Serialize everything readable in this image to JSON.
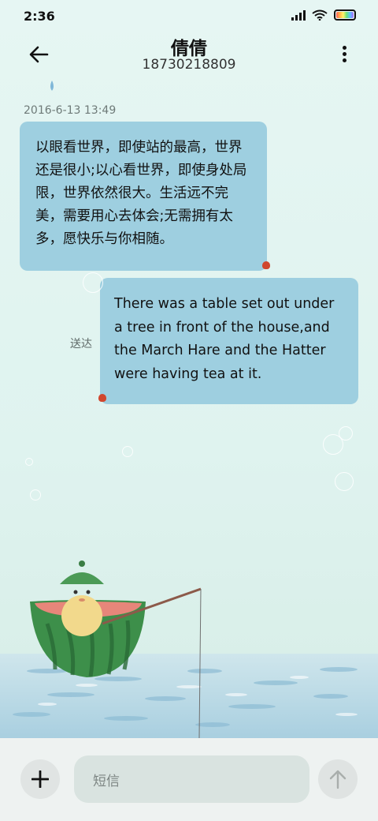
{
  "status_bar": {
    "time": "2:36",
    "icons": [
      "signal-icon",
      "wifi-icon",
      "battery-icon"
    ]
  },
  "header": {
    "contact_name": "倩倩",
    "contact_number": "18730218809",
    "back_icon": "arrow-left-icon",
    "more_icon": "more-vertical-icon"
  },
  "conversation": {
    "timestamp": "2016-6-13 13:49",
    "messages": [
      {
        "direction": "incoming",
        "text": "以眼看世界，即使站的最高，世界还是很小;以心看世界，即使身处局限，世界依然很大。生活远不完美，需要用心去体会;无需拥有太多，愿快乐与你相随。"
      },
      {
        "direction": "outgoing",
        "text": "There was a table set out under a tree in front of the house,and the March Hare and the Hatter were having tea at it.",
        "status": "送达"
      }
    ]
  },
  "composer": {
    "placeholder": "短信",
    "add_icon": "plus-icon",
    "send_icon": "arrow-up-icon"
  },
  "colors": {
    "bubble": "#9ecfe0",
    "background": "#e3f4f0"
  }
}
